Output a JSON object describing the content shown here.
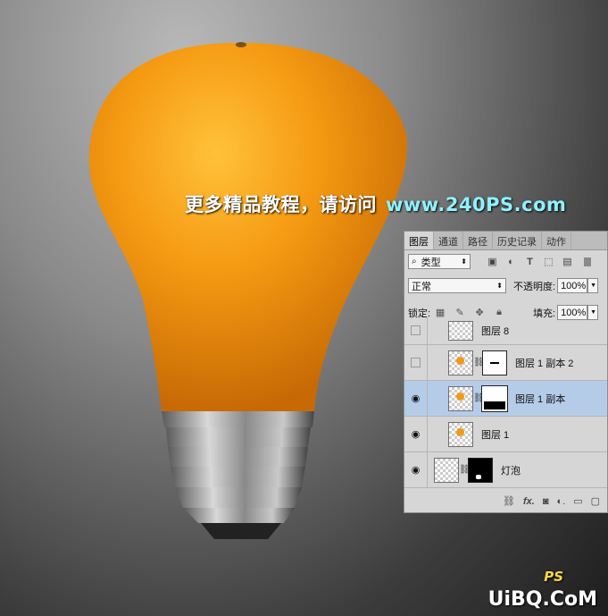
{
  "watermark": {
    "prefix": "更多精品教程，请访问",
    "site": "www.240PS.com"
  },
  "corner_logo": {
    "text": "UiBQ.CoM",
    "ps_mark": "PS"
  },
  "layers_panel": {
    "tabs": [
      "图层",
      "通道",
      "路径",
      "历史记录",
      "动作"
    ],
    "active_tab": "图层",
    "filter_label": "类型",
    "blend_mode": "正常",
    "opacity_label": "不透明度:",
    "opacity_value": "100%",
    "lock_label": "锁定:",
    "fill_label": "填充:",
    "fill_value": "100%",
    "layers": [
      {
        "name": "图层 8",
        "visible": false,
        "selected": false,
        "has_mask": false
      },
      {
        "name": "图层 1 副本 2",
        "visible": false,
        "selected": false,
        "has_mask": true
      },
      {
        "name": "图层 1 副本",
        "visible": true,
        "selected": true,
        "has_mask": true
      },
      {
        "name": "图层 1",
        "visible": true,
        "selected": false,
        "has_mask": false
      },
      {
        "name": "灯泡",
        "visible": true,
        "selected": false,
        "has_mask": true
      }
    ],
    "bottom_icons": [
      "link-icon",
      "fx-icon",
      "add-mask-icon",
      "adjustment-icon",
      "group-folder-icon",
      "new-layer-icon"
    ]
  },
  "colors": {
    "orange": "#f39a12",
    "selection": "#b5cce9",
    "watermark_site": "#8ff2ff"
  }
}
